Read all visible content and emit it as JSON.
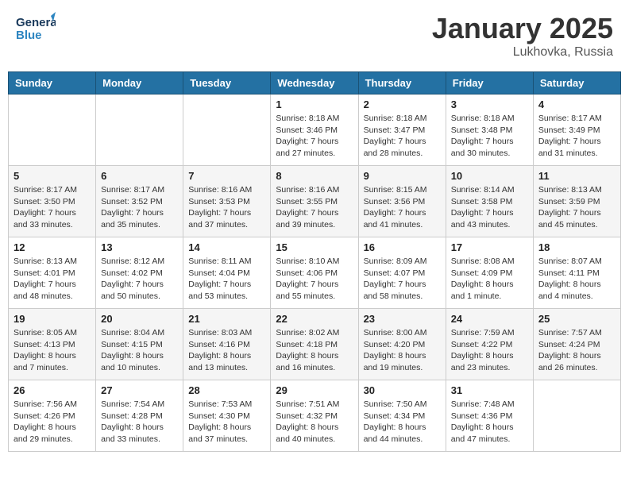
{
  "header": {
    "logo_general": "General",
    "logo_blue": "Blue",
    "month_title": "January 2025",
    "location": "Lukhovka, Russia"
  },
  "weekdays": [
    "Sunday",
    "Monday",
    "Tuesday",
    "Wednesday",
    "Thursday",
    "Friday",
    "Saturday"
  ],
  "weeks": [
    [
      {
        "day": "",
        "info": ""
      },
      {
        "day": "",
        "info": ""
      },
      {
        "day": "",
        "info": ""
      },
      {
        "day": "1",
        "info": "Sunrise: 8:18 AM\nSunset: 3:46 PM\nDaylight: 7 hours\nand 27 minutes."
      },
      {
        "day": "2",
        "info": "Sunrise: 8:18 AM\nSunset: 3:47 PM\nDaylight: 7 hours\nand 28 minutes."
      },
      {
        "day": "3",
        "info": "Sunrise: 8:18 AM\nSunset: 3:48 PM\nDaylight: 7 hours\nand 30 minutes."
      },
      {
        "day": "4",
        "info": "Sunrise: 8:17 AM\nSunset: 3:49 PM\nDaylight: 7 hours\nand 31 minutes."
      }
    ],
    [
      {
        "day": "5",
        "info": "Sunrise: 8:17 AM\nSunset: 3:50 PM\nDaylight: 7 hours\nand 33 minutes."
      },
      {
        "day": "6",
        "info": "Sunrise: 8:17 AM\nSunset: 3:52 PM\nDaylight: 7 hours\nand 35 minutes."
      },
      {
        "day": "7",
        "info": "Sunrise: 8:16 AM\nSunset: 3:53 PM\nDaylight: 7 hours\nand 37 minutes."
      },
      {
        "day": "8",
        "info": "Sunrise: 8:16 AM\nSunset: 3:55 PM\nDaylight: 7 hours\nand 39 minutes."
      },
      {
        "day": "9",
        "info": "Sunrise: 8:15 AM\nSunset: 3:56 PM\nDaylight: 7 hours\nand 41 minutes."
      },
      {
        "day": "10",
        "info": "Sunrise: 8:14 AM\nSunset: 3:58 PM\nDaylight: 7 hours\nand 43 minutes."
      },
      {
        "day": "11",
        "info": "Sunrise: 8:13 AM\nSunset: 3:59 PM\nDaylight: 7 hours\nand 45 minutes."
      }
    ],
    [
      {
        "day": "12",
        "info": "Sunrise: 8:13 AM\nSunset: 4:01 PM\nDaylight: 7 hours\nand 48 minutes."
      },
      {
        "day": "13",
        "info": "Sunrise: 8:12 AM\nSunset: 4:02 PM\nDaylight: 7 hours\nand 50 minutes."
      },
      {
        "day": "14",
        "info": "Sunrise: 8:11 AM\nSunset: 4:04 PM\nDaylight: 7 hours\nand 53 minutes."
      },
      {
        "day": "15",
        "info": "Sunrise: 8:10 AM\nSunset: 4:06 PM\nDaylight: 7 hours\nand 55 minutes."
      },
      {
        "day": "16",
        "info": "Sunrise: 8:09 AM\nSunset: 4:07 PM\nDaylight: 7 hours\nand 58 minutes."
      },
      {
        "day": "17",
        "info": "Sunrise: 8:08 AM\nSunset: 4:09 PM\nDaylight: 8 hours\nand 1 minute."
      },
      {
        "day": "18",
        "info": "Sunrise: 8:07 AM\nSunset: 4:11 PM\nDaylight: 8 hours\nand 4 minutes."
      }
    ],
    [
      {
        "day": "19",
        "info": "Sunrise: 8:05 AM\nSunset: 4:13 PM\nDaylight: 8 hours\nand 7 minutes."
      },
      {
        "day": "20",
        "info": "Sunrise: 8:04 AM\nSunset: 4:15 PM\nDaylight: 8 hours\nand 10 minutes."
      },
      {
        "day": "21",
        "info": "Sunrise: 8:03 AM\nSunset: 4:16 PM\nDaylight: 8 hours\nand 13 minutes."
      },
      {
        "day": "22",
        "info": "Sunrise: 8:02 AM\nSunset: 4:18 PM\nDaylight: 8 hours\nand 16 minutes."
      },
      {
        "day": "23",
        "info": "Sunrise: 8:00 AM\nSunset: 4:20 PM\nDaylight: 8 hours\nand 19 minutes."
      },
      {
        "day": "24",
        "info": "Sunrise: 7:59 AM\nSunset: 4:22 PM\nDaylight: 8 hours\nand 23 minutes."
      },
      {
        "day": "25",
        "info": "Sunrise: 7:57 AM\nSunset: 4:24 PM\nDaylight: 8 hours\nand 26 minutes."
      }
    ],
    [
      {
        "day": "26",
        "info": "Sunrise: 7:56 AM\nSunset: 4:26 PM\nDaylight: 8 hours\nand 29 minutes."
      },
      {
        "day": "27",
        "info": "Sunrise: 7:54 AM\nSunset: 4:28 PM\nDaylight: 8 hours\nand 33 minutes."
      },
      {
        "day": "28",
        "info": "Sunrise: 7:53 AM\nSunset: 4:30 PM\nDaylight: 8 hours\nand 37 minutes."
      },
      {
        "day": "29",
        "info": "Sunrise: 7:51 AM\nSunset: 4:32 PM\nDaylight: 8 hours\nand 40 minutes."
      },
      {
        "day": "30",
        "info": "Sunrise: 7:50 AM\nSunset: 4:34 PM\nDaylight: 8 hours\nand 44 minutes."
      },
      {
        "day": "31",
        "info": "Sunrise: 7:48 AM\nSunset: 4:36 PM\nDaylight: 8 hours\nand 47 minutes."
      },
      {
        "day": "",
        "info": ""
      }
    ]
  ]
}
